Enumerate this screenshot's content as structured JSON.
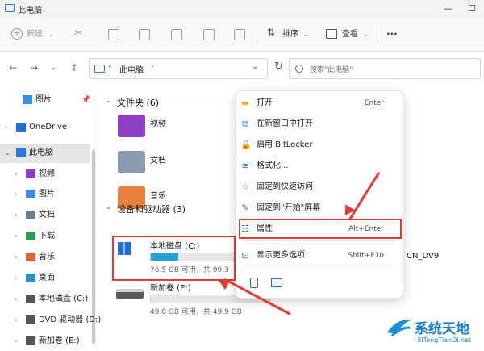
{
  "window": {
    "title": "此电脑",
    "minimize": "—",
    "maximize": "☐"
  },
  "toolbar": {
    "new_label": "新建",
    "sort_label": "排序",
    "view_label": "查看",
    "more_label": "···"
  },
  "nav": {
    "address": "此电脑",
    "search_placeholder": "搜索\"此电脑\""
  },
  "sidebar": {
    "items": [
      {
        "label": "图片",
        "color": "#3a8ee6"
      },
      {
        "label": "OneDrive",
        "color": "#1e6fd9"
      },
      {
        "label": "此电脑",
        "color": "#2b7bd6"
      },
      {
        "label": "视频",
        "color": "#8b3fc4"
      },
      {
        "label": "图片",
        "color": "#3a8ee6"
      },
      {
        "label": "文档",
        "color": "#6b7c93"
      },
      {
        "label": "下载",
        "color": "#2b9a57"
      },
      {
        "label": "音乐",
        "color": "#e0603a"
      },
      {
        "label": "桌面",
        "color": "#2a8fc8"
      },
      {
        "label": "本地磁盘 (C:)",
        "color": "#555555"
      },
      {
        "label": "DVD 驱动器 (D:)",
        "color": "#555555"
      },
      {
        "label": "新加卷 (E:)",
        "color": "#555555"
      }
    ]
  },
  "main": {
    "folders_header": "文件夹 (6)",
    "folders": [
      {
        "label": "视频",
        "color": "#8b3fc4"
      },
      {
        "label": "文档",
        "color": "#8a9bb0"
      },
      {
        "label": "音乐",
        "color": "#e8813a"
      }
    ],
    "drives_header": "设备和驱动器 (3)",
    "drives": [
      {
        "label": "本地磁盘 (C:)",
        "meta": "76.5 GB 可用，共 99.3",
        "used_fraction": 0.23
      },
      {
        "label": "新加卷 (E:)",
        "meta": "49.8 GB 可用，共 49.9 GB",
        "used_fraction": 0.0
      }
    ],
    "partial_dvd_label": "CN_DV9"
  },
  "context_menu": {
    "items": [
      {
        "label": "打开",
        "key": "Enter",
        "icon": "folder-icon"
      },
      {
        "label": "在新窗口中打开",
        "key": "",
        "icon": "open-new-window-icon"
      },
      {
        "label": "启用 BitLocker",
        "key": "",
        "icon": "bitlocker-icon"
      },
      {
        "label": "格式化...",
        "key": "",
        "icon": "format-icon"
      },
      {
        "label": "固定到快速访问",
        "key": "",
        "icon": "star-icon"
      },
      {
        "label": "固定到\"开始\"屏幕",
        "key": "",
        "icon": "pin-icon"
      },
      {
        "label": "属性",
        "key": "Alt+Enter",
        "icon": "properties-icon"
      },
      {
        "label": "显示更多选项",
        "key": "Shift+F10",
        "icon": "more-options-icon"
      }
    ]
  },
  "watermark": {
    "title": "系统天地",
    "url": "XiTongTianDi.net"
  },
  "colors": {
    "highlight": "#e53935",
    "accent": "#26a0da"
  }
}
